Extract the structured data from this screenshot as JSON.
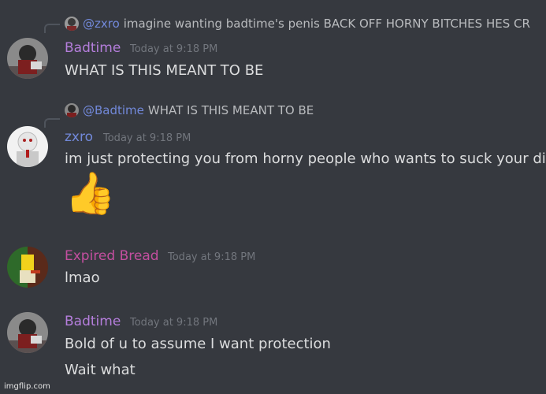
{
  "messages": [
    {
      "reply": {
        "mention": "@zxro",
        "text": "imagine wanting badtime's penis   BACK OFF HORNY BITCHES HES CR"
      },
      "author": "Badtime",
      "author_color": "#b57edc",
      "timestamp": "Today at 9:18 PM",
      "lines": [
        "WHAT IS THIS MEANT TO BE"
      ]
    },
    {
      "reply": {
        "mention": "@Badtime",
        "text": "WHAT IS THIS MEANT TO BE"
      },
      "author": "zxro",
      "author_color": "#7289da",
      "timestamp": "Today at 9:18 PM",
      "lines": [
        "im just protecting you from horny people who wants to suck your dick"
      ],
      "emoji": "👍"
    },
    {
      "author": "Expired Bread",
      "author_color": "#c44fa0",
      "timestamp": "Today at 9:18 PM",
      "lines": [
        "lmao"
      ]
    },
    {
      "author": "Badtime",
      "author_color": "#b57edc",
      "timestamp": "Today at 9:18 PM",
      "lines": [
        "Bold of u to assume I want protection",
        "Wait what"
      ]
    }
  ],
  "watermark": "imgflip.com"
}
